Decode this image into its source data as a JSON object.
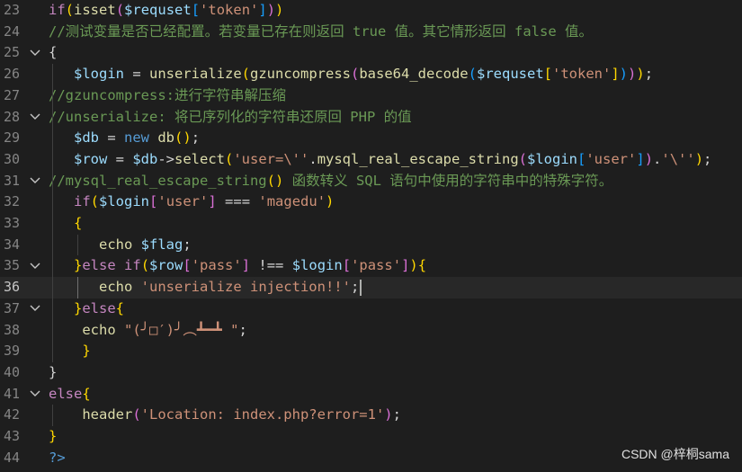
{
  "colors": {
    "background": "#1e1e1e",
    "default": "#d4d4d4",
    "keyword": "#c586c0",
    "keyword_blue": "#569cd6",
    "function": "#dcdcaa",
    "variable": "#9cdcfe",
    "string": "#ce9178",
    "comment": "#6a9955",
    "bracket1": "#ffd700",
    "bracket2": "#da70d6",
    "bracket3": "#179fff",
    "line_number": "#858585",
    "gutter_fold": "#c5c5c5"
  },
  "editor": {
    "active_line": 36,
    "lines": [
      {
        "n": "23",
        "fold": "",
        "tokens": [
          [
            "if",
            "kw"
          ],
          [
            "(",
            "b1"
          ],
          [
            "isset",
            "fn"
          ],
          [
            "(",
            "b2"
          ],
          [
            "$requset",
            "var"
          ],
          [
            "[",
            "b3"
          ],
          [
            "'token'",
            "str"
          ],
          [
            "]",
            "b3"
          ],
          [
            ")",
            "b2"
          ],
          [
            ")",
            "b1"
          ]
        ]
      },
      {
        "n": "24",
        "fold": "",
        "tokens": [
          [
            "//测试变量是否已经配置。若变量已存在则返回 true 值。其它情形返回 false 值。",
            "cm"
          ]
        ]
      },
      {
        "n": "25",
        "fold": "v",
        "tokens": [
          [
            "{",
            "p"
          ]
        ]
      },
      {
        "n": "26",
        "fold": "",
        "tokens": [
          [
            "   ",
            "p"
          ],
          [
            "$login",
            "var"
          ],
          [
            " = ",
            "p"
          ],
          [
            "unserialize",
            "fn"
          ],
          [
            "(",
            "b1"
          ],
          [
            "gzuncompress",
            "fn"
          ],
          [
            "(",
            "b2"
          ],
          [
            "base64_decode",
            "fn"
          ],
          [
            "(",
            "b3"
          ],
          [
            "$requset",
            "var"
          ],
          [
            "[",
            "b1"
          ],
          [
            "'token'",
            "str"
          ],
          [
            "]",
            "b1"
          ],
          [
            ")",
            "b3"
          ],
          [
            ")",
            "b2"
          ],
          [
            ")",
            "b1"
          ],
          [
            ";",
            "p"
          ]
        ]
      },
      {
        "n": "27",
        "fold": "",
        "tokens": [
          [
            "//gzuncompress:进行字符串解压缩",
            "cm"
          ]
        ]
      },
      {
        "n": "28",
        "fold": "v",
        "tokens": [
          [
            "//unserialize: 将已序列化的字符串还原回 PHP 的值",
            "cm"
          ]
        ]
      },
      {
        "n": "29",
        "fold": "",
        "tokens": [
          [
            "   ",
            "p"
          ],
          [
            "$db",
            "var"
          ],
          [
            " = ",
            "p"
          ],
          [
            "new",
            "kwb"
          ],
          [
            " ",
            "p"
          ],
          [
            "db",
            "fn"
          ],
          [
            "(",
            "b1"
          ],
          [
            ")",
            "b1"
          ],
          [
            ";",
            "p"
          ]
        ]
      },
      {
        "n": "30",
        "fold": "",
        "tokens": [
          [
            "   ",
            "p"
          ],
          [
            "$row",
            "var"
          ],
          [
            " = ",
            "p"
          ],
          [
            "$db",
            "var"
          ],
          [
            "->",
            "p"
          ],
          [
            "select",
            "fn"
          ],
          [
            "(",
            "b1"
          ],
          [
            "'user=\\''",
            "str"
          ],
          [
            ".",
            "p"
          ],
          [
            "mysql_real_escape_string",
            "fn"
          ],
          [
            "(",
            "b2"
          ],
          [
            "$login",
            "var"
          ],
          [
            "[",
            "b3"
          ],
          [
            "'user'",
            "str"
          ],
          [
            "]",
            "b3"
          ],
          [
            ")",
            "b2"
          ],
          [
            ".",
            "p"
          ],
          [
            "'\\''",
            "str"
          ],
          [
            ")",
            "b1"
          ],
          [
            ";",
            "p"
          ]
        ]
      },
      {
        "n": "31",
        "fold": "v",
        "tokens": [
          [
            "//mysql_real_escape_string",
            "cm"
          ],
          [
            "()",
            "b1"
          ],
          [
            " 函数转义 SQL 语句中使用的字符串中的特殊字符。",
            "cm"
          ]
        ]
      },
      {
        "n": "32",
        "fold": "",
        "tokens": [
          [
            "   ",
            "p"
          ],
          [
            "if",
            "kw"
          ],
          [
            "(",
            "b1"
          ],
          [
            "$login",
            "var"
          ],
          [
            "[",
            "b2"
          ],
          [
            "'user'",
            "str"
          ],
          [
            "]",
            "b2"
          ],
          [
            " === ",
            "p"
          ],
          [
            "'magedu'",
            "str"
          ],
          [
            ")",
            "b1"
          ]
        ]
      },
      {
        "n": "33",
        "fold": "",
        "tokens": [
          [
            "   ",
            "p"
          ],
          [
            "{",
            "b1"
          ]
        ]
      },
      {
        "n": "34",
        "fold": "",
        "tokens": [
          [
            "      ",
            "p"
          ],
          [
            "echo",
            "fn"
          ],
          [
            " ",
            "p"
          ],
          [
            "$flag",
            "var"
          ],
          [
            ";",
            "p"
          ]
        ]
      },
      {
        "n": "35",
        "fold": "v",
        "tokens": [
          [
            "   ",
            "p"
          ],
          [
            "}",
            "b1"
          ],
          [
            "else",
            "kw"
          ],
          [
            " ",
            "p"
          ],
          [
            "if",
            "kw"
          ],
          [
            "(",
            "b1"
          ],
          [
            "$row",
            "var"
          ],
          [
            "[",
            "b2"
          ],
          [
            "'pass'",
            "str"
          ],
          [
            "]",
            "b2"
          ],
          [
            " !== ",
            "p"
          ],
          [
            "$login",
            "var"
          ],
          [
            "[",
            "b2"
          ],
          [
            "'pass'",
            "str"
          ],
          [
            "]",
            "b2"
          ],
          [
            ")",
            "b1"
          ],
          [
            "{",
            "b1"
          ]
        ]
      },
      {
        "n": "36",
        "fold": "",
        "tokens": [
          [
            "      ",
            "p"
          ],
          [
            "echo",
            "fn"
          ],
          [
            " ",
            "p"
          ],
          [
            "'unserialize injection!!'",
            "str"
          ],
          [
            ";",
            "p"
          ]
        ]
      },
      {
        "n": "37",
        "fold": "v",
        "tokens": [
          [
            "   ",
            "p"
          ],
          [
            "}",
            "b1"
          ],
          [
            "else",
            "kw"
          ],
          [
            "{",
            "b1"
          ]
        ]
      },
      {
        "n": "38",
        "fold": "",
        "tokens": [
          [
            "    ",
            "p"
          ],
          [
            "echo",
            "fn"
          ],
          [
            " ",
            "p"
          ],
          [
            "\"(╯□′)╯︵┻━┻ \"",
            "str"
          ],
          [
            ";",
            "p"
          ]
        ]
      },
      {
        "n": "39",
        "fold": "",
        "tokens": [
          [
            "    ",
            "p"
          ],
          [
            "}",
            "b1"
          ]
        ]
      },
      {
        "n": "40",
        "fold": "",
        "tokens": [
          [
            "}",
            "p"
          ]
        ]
      },
      {
        "n": "41",
        "fold": "v",
        "tokens": [
          [
            "else",
            "kw"
          ],
          [
            "{",
            "b1"
          ]
        ]
      },
      {
        "n": "42",
        "fold": "",
        "tokens": [
          [
            "    ",
            "p"
          ],
          [
            "header",
            "fn"
          ],
          [
            "(",
            "b2"
          ],
          [
            "'Location: index.php?error=1'",
            "str"
          ],
          [
            ")",
            "b2"
          ],
          [
            ";",
            "p"
          ]
        ]
      },
      {
        "n": "43",
        "fold": "",
        "tokens": [
          [
            "}",
            "b1"
          ]
        ]
      },
      {
        "n": "44",
        "fold": "",
        "tokens": [
          [
            "?>",
            "kwb"
          ]
        ]
      }
    ]
  },
  "watermark": "CSDN @梓桐sama"
}
